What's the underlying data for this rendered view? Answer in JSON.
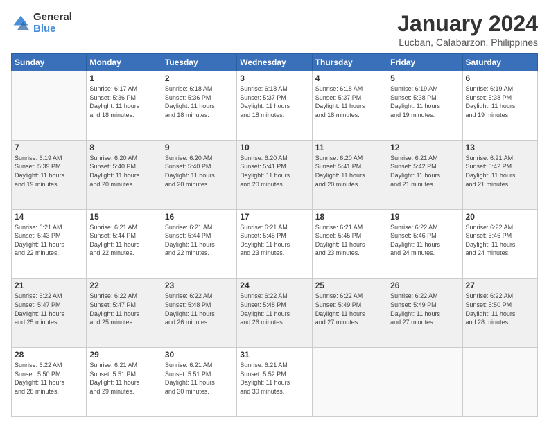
{
  "logo": {
    "line1": "General",
    "line2": "Blue"
  },
  "title": "January 2024",
  "location": "Lucban, Calabarzon, Philippines",
  "weekdays": [
    "Sunday",
    "Monday",
    "Tuesday",
    "Wednesday",
    "Thursday",
    "Friday",
    "Saturday"
  ],
  "weeks": [
    [
      {
        "day": "",
        "detail": ""
      },
      {
        "day": "1",
        "detail": "Sunrise: 6:17 AM\nSunset: 5:36 PM\nDaylight: 11 hours\nand 18 minutes."
      },
      {
        "day": "2",
        "detail": "Sunrise: 6:18 AM\nSunset: 5:36 PM\nDaylight: 11 hours\nand 18 minutes."
      },
      {
        "day": "3",
        "detail": "Sunrise: 6:18 AM\nSunset: 5:37 PM\nDaylight: 11 hours\nand 18 minutes."
      },
      {
        "day": "4",
        "detail": "Sunrise: 6:18 AM\nSunset: 5:37 PM\nDaylight: 11 hours\nand 18 minutes."
      },
      {
        "day": "5",
        "detail": "Sunrise: 6:19 AM\nSunset: 5:38 PM\nDaylight: 11 hours\nand 19 minutes."
      },
      {
        "day": "6",
        "detail": "Sunrise: 6:19 AM\nSunset: 5:38 PM\nDaylight: 11 hours\nand 19 minutes."
      }
    ],
    [
      {
        "day": "7",
        "detail": "Sunrise: 6:19 AM\nSunset: 5:39 PM\nDaylight: 11 hours\nand 19 minutes."
      },
      {
        "day": "8",
        "detail": "Sunrise: 6:20 AM\nSunset: 5:40 PM\nDaylight: 11 hours\nand 20 minutes."
      },
      {
        "day": "9",
        "detail": "Sunrise: 6:20 AM\nSunset: 5:40 PM\nDaylight: 11 hours\nand 20 minutes."
      },
      {
        "day": "10",
        "detail": "Sunrise: 6:20 AM\nSunset: 5:41 PM\nDaylight: 11 hours\nand 20 minutes."
      },
      {
        "day": "11",
        "detail": "Sunrise: 6:20 AM\nSunset: 5:41 PM\nDaylight: 11 hours\nand 20 minutes."
      },
      {
        "day": "12",
        "detail": "Sunrise: 6:21 AM\nSunset: 5:42 PM\nDaylight: 11 hours\nand 21 minutes."
      },
      {
        "day": "13",
        "detail": "Sunrise: 6:21 AM\nSunset: 5:42 PM\nDaylight: 11 hours\nand 21 minutes."
      }
    ],
    [
      {
        "day": "14",
        "detail": "Sunrise: 6:21 AM\nSunset: 5:43 PM\nDaylight: 11 hours\nand 22 minutes."
      },
      {
        "day": "15",
        "detail": "Sunrise: 6:21 AM\nSunset: 5:44 PM\nDaylight: 11 hours\nand 22 minutes."
      },
      {
        "day": "16",
        "detail": "Sunrise: 6:21 AM\nSunset: 5:44 PM\nDaylight: 11 hours\nand 22 minutes."
      },
      {
        "day": "17",
        "detail": "Sunrise: 6:21 AM\nSunset: 5:45 PM\nDaylight: 11 hours\nand 23 minutes."
      },
      {
        "day": "18",
        "detail": "Sunrise: 6:21 AM\nSunset: 5:45 PM\nDaylight: 11 hours\nand 23 minutes."
      },
      {
        "day": "19",
        "detail": "Sunrise: 6:22 AM\nSunset: 5:46 PM\nDaylight: 11 hours\nand 24 minutes."
      },
      {
        "day": "20",
        "detail": "Sunrise: 6:22 AM\nSunset: 5:46 PM\nDaylight: 11 hours\nand 24 minutes."
      }
    ],
    [
      {
        "day": "21",
        "detail": "Sunrise: 6:22 AM\nSunset: 5:47 PM\nDaylight: 11 hours\nand 25 minutes."
      },
      {
        "day": "22",
        "detail": "Sunrise: 6:22 AM\nSunset: 5:47 PM\nDaylight: 11 hours\nand 25 minutes."
      },
      {
        "day": "23",
        "detail": "Sunrise: 6:22 AM\nSunset: 5:48 PM\nDaylight: 11 hours\nand 26 minutes."
      },
      {
        "day": "24",
        "detail": "Sunrise: 6:22 AM\nSunset: 5:48 PM\nDaylight: 11 hours\nand 26 minutes."
      },
      {
        "day": "25",
        "detail": "Sunrise: 6:22 AM\nSunset: 5:49 PM\nDaylight: 11 hours\nand 27 minutes."
      },
      {
        "day": "26",
        "detail": "Sunrise: 6:22 AM\nSunset: 5:49 PM\nDaylight: 11 hours\nand 27 minutes."
      },
      {
        "day": "27",
        "detail": "Sunrise: 6:22 AM\nSunset: 5:50 PM\nDaylight: 11 hours\nand 28 minutes."
      }
    ],
    [
      {
        "day": "28",
        "detail": "Sunrise: 6:22 AM\nSunset: 5:50 PM\nDaylight: 11 hours\nand 28 minutes."
      },
      {
        "day": "29",
        "detail": "Sunrise: 6:21 AM\nSunset: 5:51 PM\nDaylight: 11 hours\nand 29 minutes."
      },
      {
        "day": "30",
        "detail": "Sunrise: 6:21 AM\nSunset: 5:51 PM\nDaylight: 11 hours\nand 30 minutes."
      },
      {
        "day": "31",
        "detail": "Sunrise: 6:21 AM\nSunset: 5:52 PM\nDaylight: 11 hours\nand 30 minutes."
      },
      {
        "day": "",
        "detail": ""
      },
      {
        "day": "",
        "detail": ""
      },
      {
        "day": "",
        "detail": ""
      }
    ]
  ]
}
